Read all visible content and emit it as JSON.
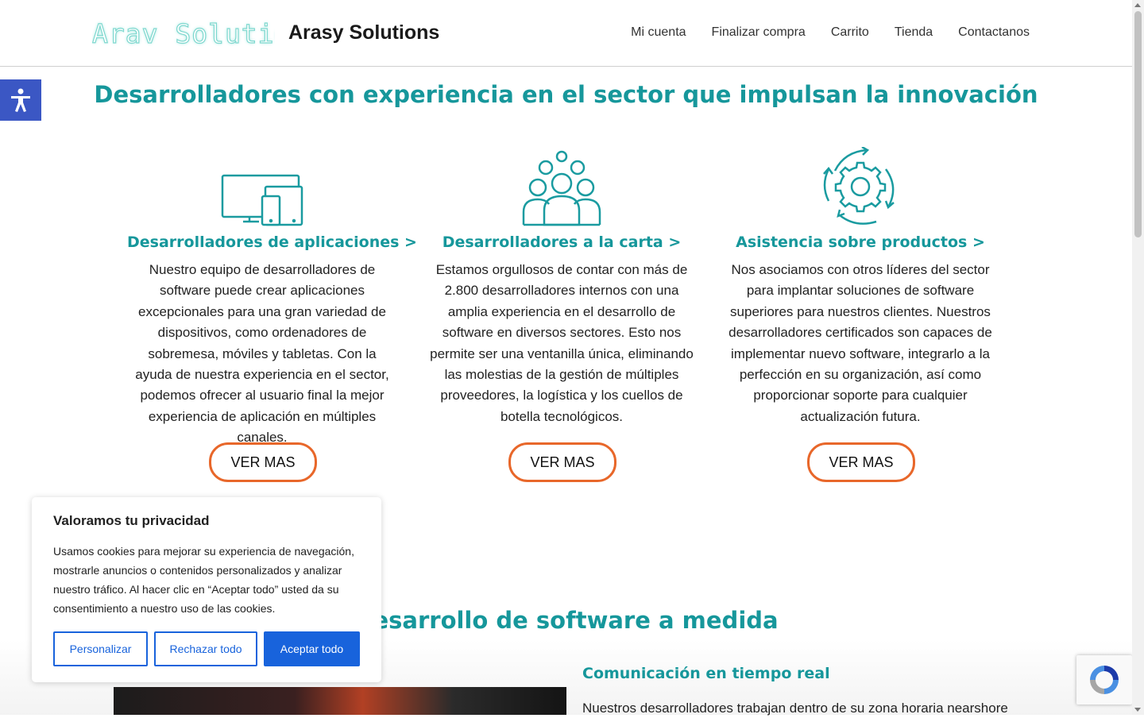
{
  "header": {
    "logo_text": "Arav Solutions",
    "site_title": "Arasy Solutions",
    "nav": [
      "Mi cuenta",
      "Finalizar compra",
      "Carrito",
      "Tienda",
      "Contactanos"
    ]
  },
  "services": {
    "title": "Desarrolladores con experiencia en el sector que impulsan la innovación",
    "columns": [
      {
        "icon": "devices-icon",
        "heading": "Desarrolladores de aplicaciones >",
        "text": "Nuestro equipo de desarrolladores de software puede crear aplicaciones excepcionales para una gran variedad de dispositivos, como ordenadores de sobremesa, móviles y tabletas. Con la ayuda de nuestra experiencia en el sector, podemos ofrecer al usuario final la mejor experiencia de aplicación en múltiples canales.",
        "button": "VER MAS"
      },
      {
        "icon": "team-icon",
        "heading": "Desarrolladores a la carta >",
        "text": "Estamos orgullosos de contar con más de 2.800 desarrolladores internos con una amplia experiencia en el desarrollo de software en diversos sectores. Esto nos permite ser una ventanilla única, eliminando las molestias de la gestión de múltiples proveedores, la logística y los cuellos de botella tecnológicos.",
        "button": "VER MAS"
      },
      {
        "icon": "gear-cycle-icon",
        "heading": "Asistencia sobre productos >",
        "text": "Nos asociamos con otros líderes del sector para implantar soluciones de software superiores para nuestros clientes. Nuestros desarrolladores certificados son capaces de implementar nuevo software, integrarlo a la perfección en su organización, así como proporcionar soporte para cualquier actualización futura.",
        "button": "VER MAS"
      }
    ]
  },
  "custom_software": {
    "title": "Desarrollo de software a medida",
    "subtitle": "Comunicación en tiempo real",
    "text": "Nuestros desarrolladores trabajan dentro de su zona horaria nearshore"
  },
  "cookie_banner": {
    "title": "Valoramos tu privacidad",
    "text": "Usamos cookies para mejorar su experiencia de navegación, mostrarle anuncios o contenidos personalizados y analizar nuestro tráfico. Al hacer clic en “Aceptar todo” usted da su consentimiento a nuestro uso de las cookies.",
    "btn_customize": "Personalizar",
    "btn_reject": "Rechazar todo",
    "btn_accept": "Aceptar todo"
  },
  "colors": {
    "accent": "#16979b",
    "button_border": "#e8672a",
    "cookie_blue": "#1863dc",
    "a11y_blue": "#3b57c4"
  }
}
